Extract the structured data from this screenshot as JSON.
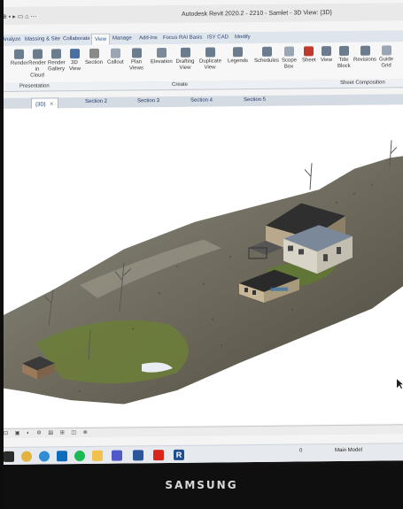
{
  "window": {
    "title": "Autodesk Revit 2020.2 - 2210 - Samlet - 3D View: {3D}",
    "quick_access": "⊕ ▪ ▸ ▭ ⌂ ⋯"
  },
  "ribbon_tabs": [
    {
      "label": "Analyze",
      "active": false
    },
    {
      "label": "Massing & Site",
      "active": false
    },
    {
      "label": "Collaborate",
      "active": false
    },
    {
      "label": "View",
      "active": true
    },
    {
      "label": "Manage",
      "active": false
    },
    {
      "label": "Add-Ins",
      "active": false
    },
    {
      "label": "Focus RAI Basis",
      "active": false
    },
    {
      "label": "ISY CAD",
      "active": false
    },
    {
      "label": "Modify",
      "active": false
    }
  ],
  "ribbon_buttons": [
    {
      "label": "Render",
      "icon": "teapot-icon"
    },
    {
      "label": "Render in Cloud",
      "icon": "cloud-teapot-icon"
    },
    {
      "label": "Render Gallery",
      "icon": "gallery-icon"
    },
    {
      "label": "3D View",
      "icon": "house-3d-icon"
    },
    {
      "label": "Section",
      "icon": "section-icon"
    },
    {
      "label": "Callout",
      "icon": "callout-icon"
    },
    {
      "label": "Plan Views",
      "icon": "plan-icon"
    },
    {
      "label": "Elevation",
      "icon": "elevation-icon"
    },
    {
      "label": "Drafting View",
      "icon": "drafting-icon"
    },
    {
      "label": "Duplicate View",
      "icon": "duplicate-icon"
    },
    {
      "label": "Legends",
      "icon": "legend-icon"
    },
    {
      "label": "Schedules",
      "icon": "schedule-icon"
    },
    {
      "label": "Scope Box",
      "icon": "scope-box-icon"
    },
    {
      "label": "Sheet",
      "icon": "sheet-icon"
    },
    {
      "label": "View",
      "icon": "view-icon"
    },
    {
      "label": "Title Block",
      "icon": "title-block-icon"
    },
    {
      "label": "Revisions",
      "icon": "revisions-icon"
    },
    {
      "label": "Guide Grid",
      "icon": "guide-grid-icon"
    }
  ],
  "ribbon_panels": {
    "presentation": "Presentation",
    "create": "Create",
    "sheet_composition": "Sheet Composition"
  },
  "view_tabs": [
    {
      "label": "{3D}",
      "active": true
    },
    {
      "label": "Section 2",
      "active": false
    },
    {
      "label": "Section 3",
      "active": false
    },
    {
      "label": "Section 4",
      "active": false
    },
    {
      "label": "Section 5",
      "active": false
    }
  ],
  "status_bar": {
    "coord": "0",
    "workset": "Main Model"
  },
  "taskbar_icons": [
    "windows-start-icon",
    "chrome-icon",
    "edge-icon",
    "outlook-icon",
    "spotify-icon",
    "file-explorer-icon",
    "teams-icon",
    "word-icon",
    "acrobat-icon",
    "revit-icon"
  ],
  "monitor_brand": "SAMSUNG",
  "colors": {
    "ribbon_accent": "#1f4e8c",
    "terrain_green": "#6b7d3a",
    "roof_dark": "#3a3a3a"
  }
}
